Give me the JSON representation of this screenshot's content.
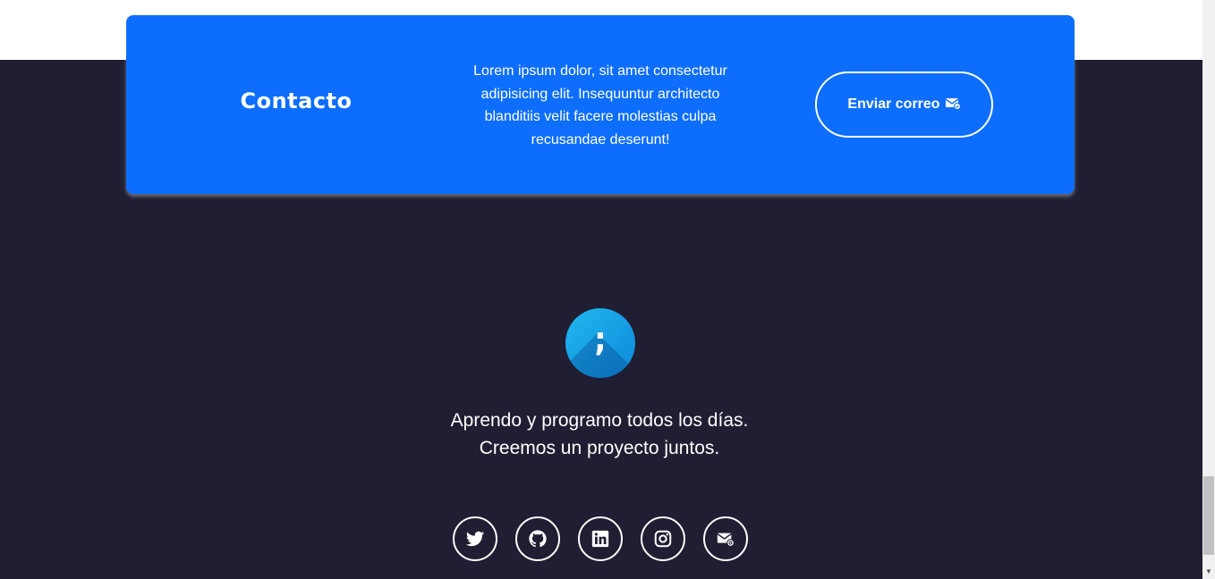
{
  "contact": {
    "title": "Contacto",
    "text": "Lorem ipsum dolor, sit amet consectetur adipisicing elit. Insequuntur architecto blanditiis velit facere molestias culpa recusandae deserunt!",
    "button_label": "Enviar correo",
    "button_icon": "mail-icon"
  },
  "footer": {
    "logo_glyph": ";",
    "tagline_line1": "Aprendo y programo todos los días.",
    "tagline_line2": "Creemos un proyecto juntos.",
    "social": [
      "twitter-icon",
      "github-icon",
      "linkedin-icon",
      "instagram-icon",
      "email-icon"
    ]
  },
  "colors": {
    "card_blue": "#0d6efd",
    "background_dark": "#1f1e33",
    "white": "#ffffff"
  }
}
